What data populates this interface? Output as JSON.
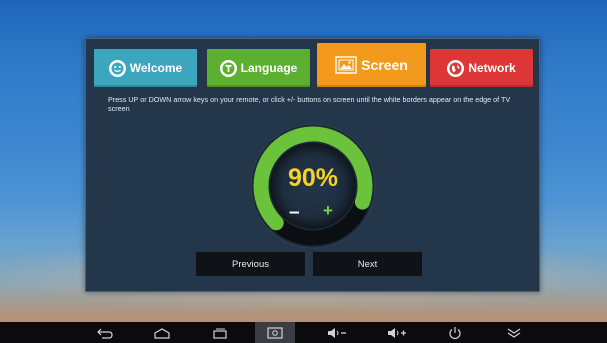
{
  "colors": {
    "tab_welcome": "#3da6bf",
    "tab_language": "#5caf2f",
    "tab_screen": "#f39a1c",
    "tab_network": "#dc3636",
    "dial_green": "#6bc33c",
    "percent_text": "#f5d327"
  },
  "tabs": [
    {
      "label": "Welcome",
      "icon": "smiley-icon"
    },
    {
      "label": "Language",
      "icon": "t-letter-icon"
    },
    {
      "label": "Screen",
      "icon": "screen-frame-icon"
    },
    {
      "label": "Network",
      "icon": "globe-icon"
    }
  ],
  "active_tab": "Screen",
  "instructions": "Press UP or DOWN arrow keys on your remote, or click +/- buttons on screen until the white borders appear on the edge of TV screen",
  "dial": {
    "value_label": "90%",
    "value": 90,
    "minus_label": "–",
    "plus_label": "+"
  },
  "buttons": {
    "previous": "Previous",
    "next": "Next"
  },
  "navbar": [
    {
      "name": "back-icon"
    },
    {
      "name": "home-icon"
    },
    {
      "name": "recent-apps-icon"
    },
    {
      "name": "screenshot-icon"
    },
    {
      "name": "volume-down-icon"
    },
    {
      "name": "volume-up-icon"
    },
    {
      "name": "power-icon"
    },
    {
      "name": "hide-bar-icon"
    }
  ]
}
